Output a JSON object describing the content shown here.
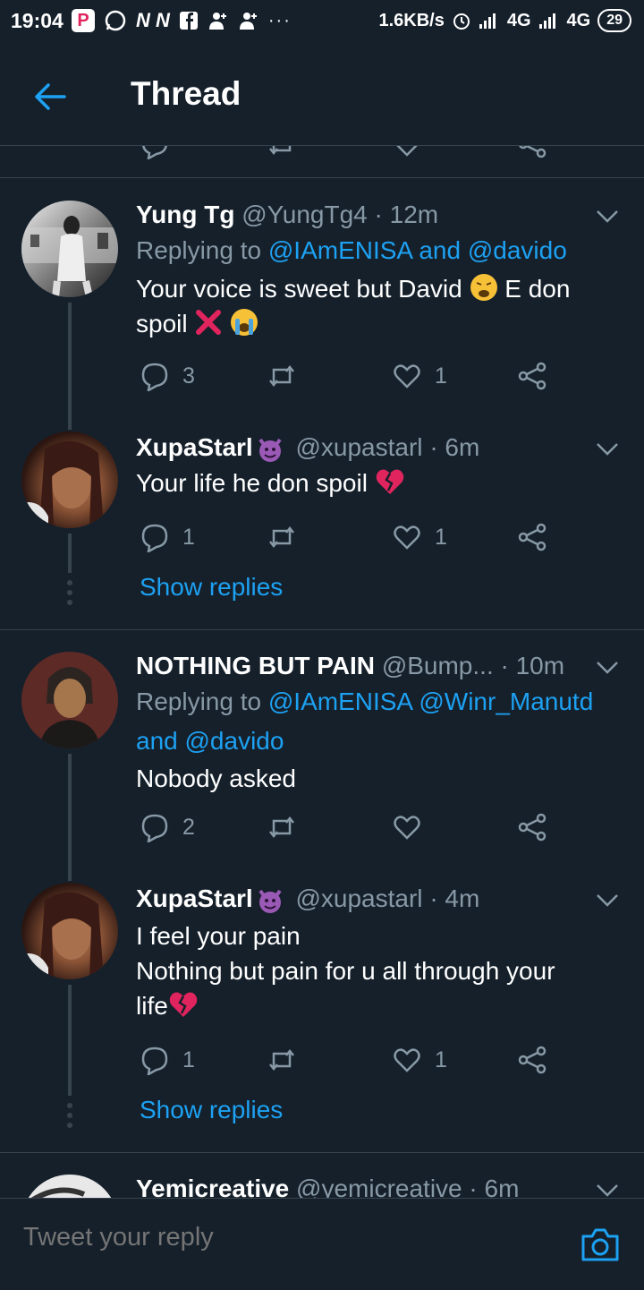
{
  "status_bar": {
    "time": "19:04",
    "app_icon_p": "P",
    "icons_mid": "N N",
    "dots": "···",
    "speed": "1.6KB/s",
    "network1": "4G",
    "network2": "4G",
    "battery": "29"
  },
  "header": {
    "title": "Thread",
    "back_icon": "arrow-left-icon"
  },
  "colors": {
    "background": "#15202b",
    "accent": "#1da1f2",
    "muted": "#8899a6",
    "divider": "#38444d"
  },
  "tweets": [
    {
      "name": "Yung Tg",
      "handle": "@YungTg4",
      "time": "· 12m",
      "replying_prefix": "Replying to",
      "mention1": "@IAmENISA",
      "and": "and",
      "mention2": "@davido",
      "body_line1": "Your voice is sweet but David",
      "body_mid": "E don",
      "body_line2": "spoil",
      "replies": "3",
      "likes": "1"
    },
    {
      "name": "XupaStarl",
      "handle": "@xupastarl",
      "time": "· 6m",
      "body": "Your life he don spoil",
      "replies": "1",
      "likes": "1",
      "show_replies": "Show replies"
    },
    {
      "name": "NOTHING BUT PAIN",
      "handle": "@Bump...",
      "time": "· 10m",
      "replying_prefix": "Replying to",
      "mention1": "@IAmENISA",
      "mention2": "@Winr_Manutd",
      "and": "and",
      "mention3": "@davido",
      "body": "Nobody asked",
      "replies": "2",
      "likes": ""
    },
    {
      "name": "XupaStarl",
      "handle": "@xupastarl",
      "time": "· 4m",
      "body_line1": "I feel your pain",
      "body_line2": "Nothing but pain for u all through your",
      "body_line3": "life",
      "replies": "1",
      "likes": "1",
      "show_replies": "Show replies"
    },
    {
      "name": "Yemicreative",
      "handle": "@yemicreative",
      "time": "· 6m"
    }
  ],
  "compose": {
    "placeholder": "Tweet your reply",
    "camera_icon": "camera-icon"
  }
}
